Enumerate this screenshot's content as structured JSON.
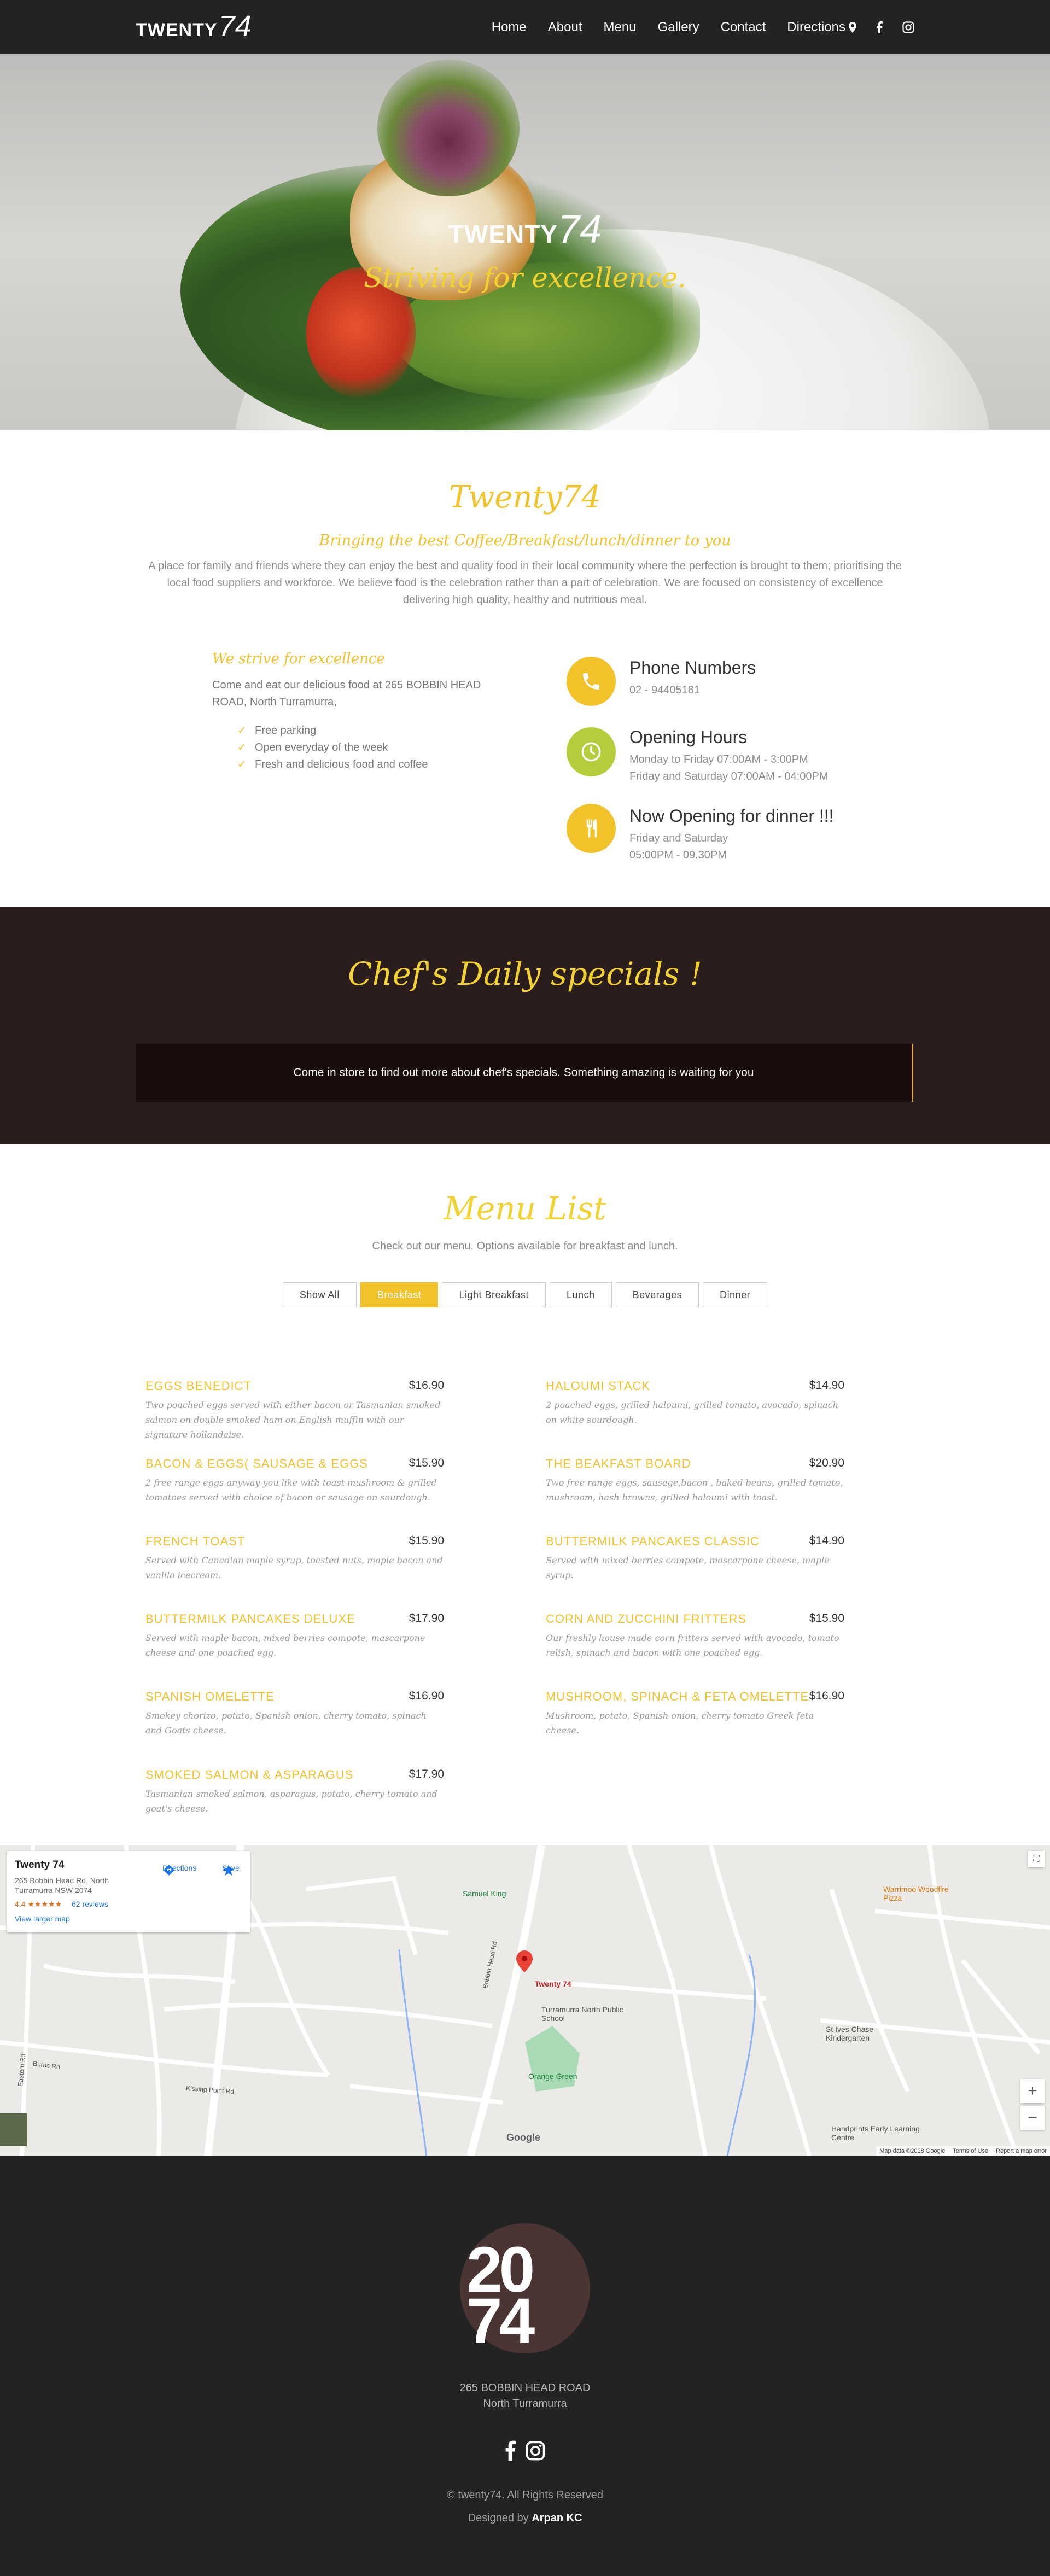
{
  "nav": {
    "logo_text": "TWENTY",
    "logo_num": "74",
    "links": [
      "Home",
      "About",
      "Menu",
      "Gallery",
      "Contact",
      "Directions"
    ]
  },
  "hero": {
    "logo_text": "TWENTY",
    "logo_num": "74",
    "tagline": "Striving for excellence."
  },
  "intro": {
    "title": "Twenty74",
    "subtitle": "Bringing the best Coffee/Breakfast/lunch/dinner to you",
    "text": "A place for family and friends where they can enjoy the best and quality food in their local community where the perfection is brought to them; prioritising the local food suppliers and workforce. We believe food is the celebration rather than a part of celebration. We are focused on consistency of excellence delivering high quality, healthy and nutritious meal."
  },
  "strive": {
    "title": "We strive for excellence",
    "text": "Come and eat our delicious food at 265 BOBBIN HEAD ROAD, North Turramurra,",
    "features": [
      "Free parking",
      "Open everyday of the week",
      "Fresh and delicious food and coffee"
    ]
  },
  "info": {
    "phone_title": "Phone Numbers",
    "phone": "02 - 94405181",
    "hours_title": "Opening Hours",
    "hours_1": "Monday to Friday 07:00AM - 3:00PM",
    "hours_2": "Friday and Saturday 07:00AM - 04:00PM",
    "dinner_title": "Now Opening for dinner !!!",
    "dinner_1": "Friday and Saturday",
    "dinner_2": "05:00PM - 09.30PM",
    "colors": {
      "phone": "#f2c22b",
      "hours": "#b7cc3a",
      "dinner": "#f2c22b"
    }
  },
  "specials": {
    "title": "Chef's Daily specials !",
    "text": "Come in store to find out more about chef's specials. Something amazing is waiting for you"
  },
  "menu": {
    "title": "Menu List",
    "subtitle": "Check out our menu. Options available for breakfast and lunch.",
    "tabs": [
      "Show All",
      "Breakfast",
      "Light Breakfast",
      "Lunch",
      "Beverages",
      "Dinner"
    ],
    "active_tab": "Breakfast",
    "items": [
      {
        "name": "Eggs Benedict",
        "price": "$16.90",
        "desc": "Two poached eggs served with either bacon or Tasmanian smoked salmon on double smoked ham on English muffin with our signature hollandaise."
      },
      {
        "name": "Haloumi Stack",
        "price": "$14.90",
        "desc": "2 poached eggs, grilled haloumi, grilled tomato, avocado, spinach on white sourdough."
      },
      {
        "name": "Bacon & Eggs( Sausage & Eggs",
        "price": "$15.90",
        "desc": "2 free range eggs anyway you like with toast mushroom & grilled tomatoes served with choice of bacon or sausage on sourdough."
      },
      {
        "name": "The Beakfast Board",
        "price": "$20.90",
        "desc": "Two free range eggs, sausage,bacon , baked beans, grilled tomato, mushroom, hash browns, grilled haloumi with toast."
      },
      {
        "name": "French Toast",
        "price": "$15.90",
        "desc": "Served with Canadian maple syrup, toasted nuts, maple bacon and vanilla icecream."
      },
      {
        "name": "Buttermilk pancakes Classic",
        "price": "$14.90",
        "desc": "Served with mixed berries compote, mascarpone cheese, maple syrup."
      },
      {
        "name": "Buttermilk pancakes Deluxe",
        "price": "$17.90",
        "desc": "Served with maple bacon, mixed berries compote, mascarpone cheese and one poached egg."
      },
      {
        "name": "Corn and Zucchini fritters",
        "price": "$15.90",
        "desc": "Our freshly house made corn fritters served with avocado, tomato relish, spinach and bacon with one poached egg."
      },
      {
        "name": "Spanish Omelette",
        "price": "$16.90",
        "desc": "Smokey chorizo, potato, Spanish onion, cherry tomato, spinach and Goats cheese."
      },
      {
        "name": "Mushroom, Spinach & Feta Omelette",
        "price": "$16.90",
        "desc": "Mushroom, potato, Spanish onion, cherry tomato Greek feta cheese."
      },
      {
        "name": "Smoked Salmon & Asparagus",
        "price": "$17.90",
        "desc": "Tasmanian smoked salmon, asparagus, potato, cherry tomato and goat's cheese."
      }
    ]
  },
  "map": {
    "place_name": "Twenty 74",
    "address": "265 Bobbin Head Rd, North Turramurra NSW 2074",
    "rating": "4.4",
    "stars": "★★★★★",
    "reviews": "62 reviews",
    "view_larger": "View larger map",
    "directions": "Directions",
    "save": "Save",
    "labels": {
      "samuel_king": "Samuel King",
      "marker": "Twenty 74",
      "school": "Turramurra North Public School",
      "orange_green": "Orange Green",
      "st_ives": "St Ives Chase Kindergarten",
      "handprints": "Handprints Early Learning Centre",
      "warrimoo": "Warrimoo Woodfire Pizza",
      "bobbin_head": "Bobbin Head Rd",
      "burns_rd": "Burns Rd",
      "eastern_rd": "Eastern Rd",
      "kissing_point": "Kissing Point Rd"
    },
    "attribution": [
      "Map data ©2018 Google",
      "Terms of Use",
      "Report a map error"
    ],
    "google": "Google"
  },
  "footer": {
    "badge_1": "20",
    "badge_2": "74",
    "address_1": "265 BOBBIN HEAD ROAD",
    "address_2": "North Turramurra",
    "copyright": "© twenty74. All Rights Reserved",
    "designed_prefix": "Designed by",
    "designer": "Arpan KC"
  }
}
